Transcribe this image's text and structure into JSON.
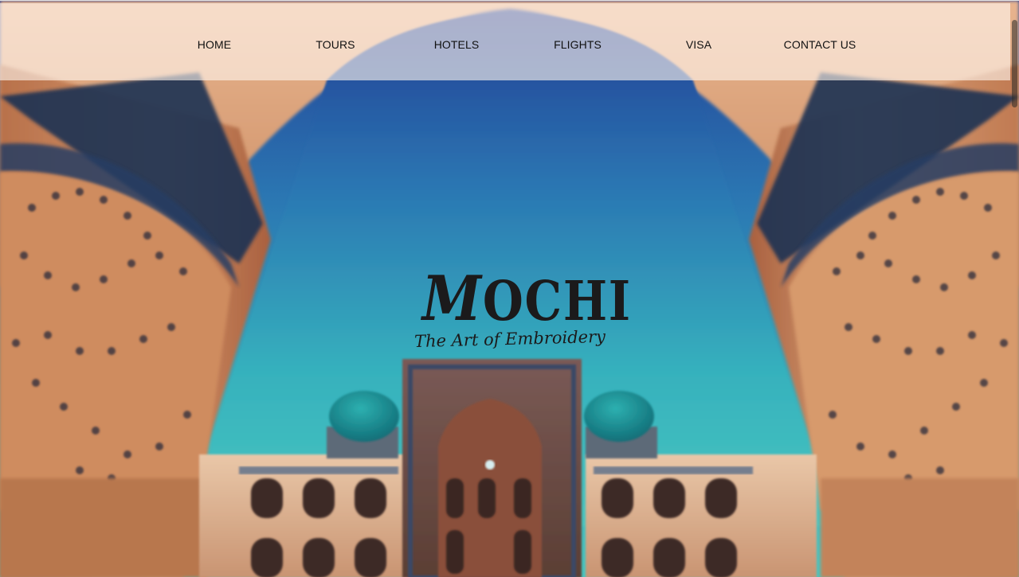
{
  "nav": {
    "items": [
      {
        "label": "HOME"
      },
      {
        "label": "TOURS"
      },
      {
        "label": "HOTELS"
      },
      {
        "label": "FLIGHTS"
      },
      {
        "label": "VISA"
      },
      {
        "label": "CONTACT US"
      }
    ]
  },
  "logo": {
    "title_initial": "M",
    "title_rest": "OCHI",
    "tagline": "The Art of Embroidery"
  },
  "colors": {
    "sky_top": "#1f4a9a",
    "sky_bottom": "#3cc0c0",
    "brick": "#c8845a",
    "tile_blue": "#1e3556",
    "dome": "#1a8a8f",
    "nav_overlay": "#fff6ee",
    "text": "#111111"
  }
}
